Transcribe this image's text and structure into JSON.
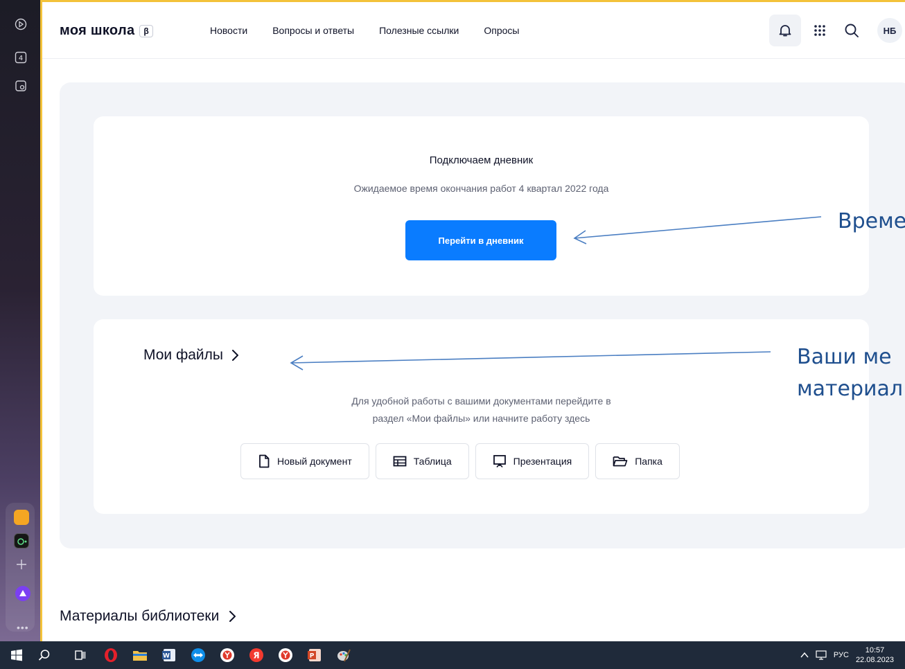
{
  "header": {
    "logo": "моя школа",
    "beta": "β",
    "nav": [
      "Новости",
      "Вопросы и ответы",
      "Полезные ссылки",
      "Опросы"
    ],
    "avatar": "НБ"
  },
  "diary": {
    "title": "Подключаем дневник",
    "subtitle": "Ожидаемое время окончания работ 4 квартал 2022 года",
    "button": "Перейти в дневник"
  },
  "files": {
    "title": "Мои файлы",
    "desc_line1": "Для удобной работы с вашими документами перейдите в",
    "desc_line2": "раздел «Мои файлы» или начните работу здесь",
    "buttons": [
      "Новый документ",
      "Таблица",
      "Презентация",
      "Папка"
    ]
  },
  "library": {
    "title": "Материалы библиотеки"
  },
  "annotations": {
    "a1": "Време",
    "a2_line1": "Ваши ме",
    "a2_line2": "материал"
  },
  "taskbar": {
    "lang": "РУС",
    "time": "10:57",
    "date": "22.08.2023"
  },
  "colors": {
    "accent": "#0a7cff",
    "frame": "#f3c23a",
    "annotation": "#1f4f8e"
  }
}
